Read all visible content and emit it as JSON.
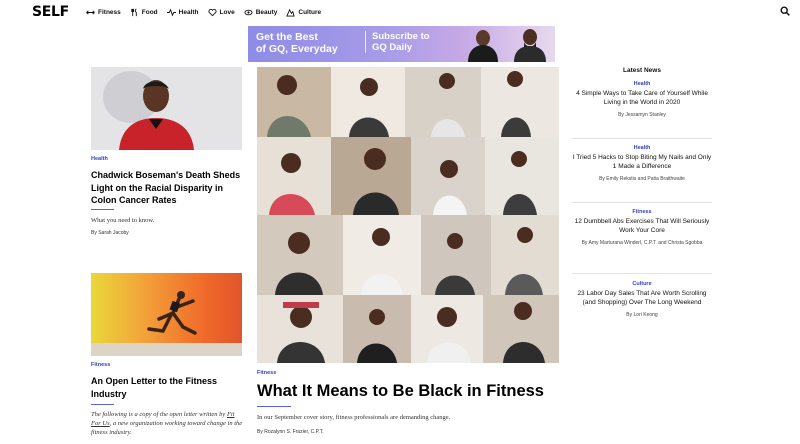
{
  "site": {
    "logo": "SELF"
  },
  "nav": {
    "items": [
      {
        "label": "Fitness",
        "icon": "fitness-icon"
      },
      {
        "label": "Food",
        "icon": "food-icon"
      },
      {
        "label": "Health",
        "icon": "health-icon"
      },
      {
        "label": "Love",
        "icon": "love-icon"
      },
      {
        "label": "Beauty",
        "icon": "beauty-icon"
      },
      {
        "label": "Culture",
        "icon": "culture-icon"
      }
    ],
    "search_icon": "search-icon"
  },
  "ad": {
    "left_line1": "Get the Best",
    "left_line2": "of GQ, Everyday",
    "right_line1": "Subscribe to",
    "right_line2": "GQ Daily"
  },
  "left": {
    "article1": {
      "tag": "Health",
      "title": "Chadwick Boseman's Death Sheds Light on the Racial Disparity in Colon Cancer Rates",
      "dek": "What you need to know.",
      "byline": "By Sarah Jacoby"
    },
    "article2": {
      "tag": "Fitness",
      "title": "An Open Letter to the Fitness Industry",
      "dek_prefix": "The following is a copy of the open letter written by ",
      "dek_link": "Fit For Us",
      "dek_suffix": ", a new organization working toward change in the fitness industry."
    }
  },
  "main": {
    "tag": "Fitness",
    "title": "What It Means to Be Black in Fitness",
    "dek": "In our September cover story, fitness professionals are demanding change.",
    "byline": "By Rozalynn S. Frazier, C.P.T."
  },
  "latest": {
    "heading": "Latest News",
    "items": [
      {
        "tag": "Health",
        "title": "4 Simple Ways to Take Care of Yourself While Living in the World in 2020",
        "byline": "By Jessamyn Stanley"
      },
      {
        "tag": "Health",
        "title": "I Tried 5 Hacks to Stop Biting My Nails and Only 1 Made a Difference",
        "byline": "By Emily Rekstis and Patia Braithwaite"
      },
      {
        "tag": "Fitness",
        "title": "12 Dumbbell Abs Exercises That Will Seriously Work Your Core",
        "byline": "By Amy Marturana Winderl, C.P.T. and Christa Sgobba"
      },
      {
        "tag": "Culture",
        "title": "23 Labor Day Sales That Are Worth Scrolling (and Shopping) Over The Long Weekend",
        "byline": "By Lori Keong"
      }
    ]
  },
  "colors": {
    "accent": "#2f3fc4",
    "rule": "#5a63d6"
  }
}
